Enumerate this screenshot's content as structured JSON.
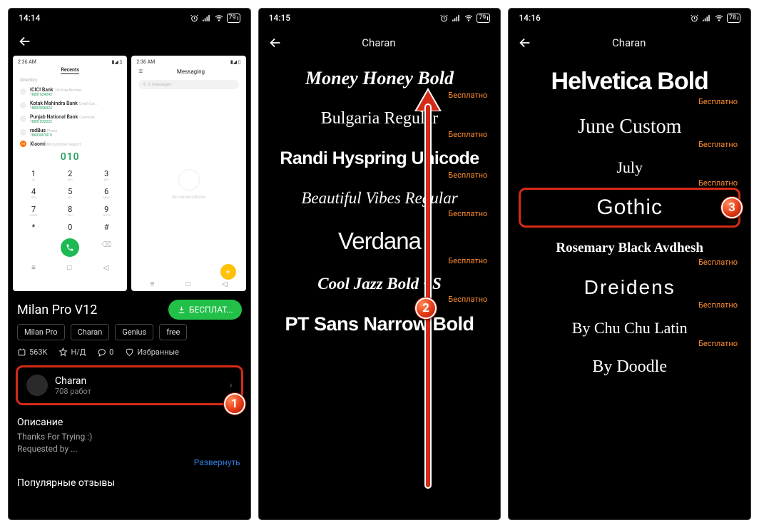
{
  "status": {
    "time1": "14:14",
    "time2": "14:15",
    "time3": "14:16",
    "battery1": "79",
    "battery2": "79",
    "battery3": "78"
  },
  "panel1": {
    "preview1": {
      "time": "2:36 AM",
      "tabs": {
        "recents": "Recents"
      },
      "directory": "Directory",
      "rows": [
        {
          "name": "ICICI Bank",
          "meta": "Toll Free Number",
          "num": "18001024242"
        },
        {
          "name": "Kotak Mahindra Bank",
          "meta": "Credit Car...",
          "num": "18002096022"
        },
        {
          "name": "Punjab National Bank",
          "meta": "Customer...",
          "num": "18001032222"
        },
        {
          "name": "redBus",
          "meta": "Phone",
          "num": "18603001010"
        },
        {
          "name": "Xiaomi",
          "meta": "Mi Customer Support",
          "num": ""
        }
      ],
      "dialed": "010",
      "keys": [
        {
          "d": "1",
          "l": "∞"
        },
        {
          "d": "2",
          "l": "ABC"
        },
        {
          "d": "3",
          "l": "DEF"
        },
        {
          "d": "4",
          "l": "GHI"
        },
        {
          "d": "5",
          "l": "JKL"
        },
        {
          "d": "6",
          "l": "MNO"
        },
        {
          "d": "7",
          "l": "PQRS"
        },
        {
          "d": "8",
          "l": "TUV"
        },
        {
          "d": "9",
          "l": "WXYZ"
        },
        {
          "d": "*",
          "l": ""
        },
        {
          "d": "0",
          "l": "+"
        },
        {
          "d": "#",
          "l": ""
        }
      ],
      "nav": [
        "≡",
        "□",
        "◁"
      ]
    },
    "preview2": {
      "title": "Messaging",
      "search": "0 messages",
      "empty": "No conversations"
    },
    "theme_title": "Milan Pro V12",
    "download_label": "БЕСПЛАТ...",
    "tags": [
      "Milan Pro",
      "Charan",
      "Genius",
      "free"
    ],
    "stats": {
      "downloads": "563K",
      "rating": "Н/Д",
      "comments": "0",
      "fav": "Избранные"
    },
    "author": {
      "name": "Charan",
      "works": "708 работ"
    },
    "desc_heading": "Описание",
    "desc_text": "Thanks For Trying :)\nRequested by ...",
    "expand": "Развернуть",
    "reviews_heading": "Популярные отзывы"
  },
  "panel2": {
    "title": "Charan",
    "fonts": [
      {
        "name": "Money Honey Bold",
        "cls": "ff-brush"
      },
      {
        "name": "Bulgaria Regular",
        "cls": "ff-script"
      },
      {
        "name": "Randi Hyspring Unicode",
        "cls": "ff-cond"
      },
      {
        "name": "Beautiful Vibes Regular",
        "cls": "ff-cursive"
      },
      {
        "name": "Verdana",
        "cls": "ff-verdana"
      },
      {
        "name": "Cool Jazz Bold +S",
        "cls": "ff-jazz"
      },
      {
        "name": "PT Sans Narrow Bold",
        "cls": "ff-ptsans"
      }
    ],
    "free_label": "Бесплатно"
  },
  "panel3": {
    "title": "Charan",
    "free_label": "Бесплатно",
    "fonts": [
      {
        "name": "Helvetica Bold",
        "cls": "ff-helv"
      },
      {
        "name": "June Custom",
        "cls": "ff-june"
      },
      {
        "name": "July",
        "cls": "ff-july"
      },
      {
        "name": "Gothic",
        "cls": "ff-gothic",
        "highlight": true
      },
      {
        "name": "Rosemary Black Avdhesh",
        "cls": "ff-rosemary"
      },
      {
        "name": "Dreidens",
        "cls": "ff-dreidens"
      },
      {
        "name": "By Chu Chu Latin",
        "cls": "ff-chu"
      },
      {
        "name": "By Doodle",
        "cls": "ff-doodle"
      }
    ]
  },
  "badges": {
    "b1": "1",
    "b2": "2",
    "b3": "3"
  }
}
